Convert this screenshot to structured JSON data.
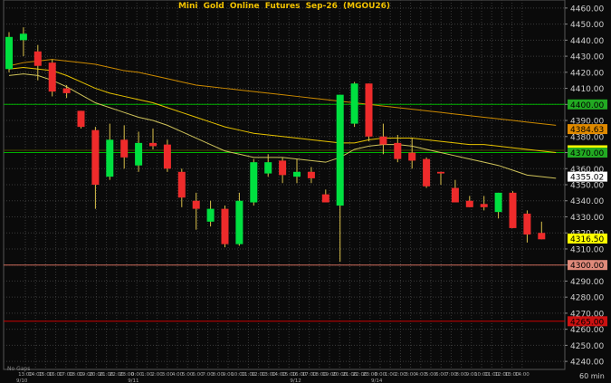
{
  "chart_data": {
    "type": "candlestick",
    "title": "Mini Gold Online Futures Sep-26 (MGOU26)",
    "timeframe_label": "60 min",
    "footnote": "No Gaps",
    "ylim": [
      4235,
      4465
    ],
    "y_ticks": [
      4460,
      4450,
      4440,
      4430,
      4420,
      4410,
      4400,
      4390,
      4380,
      4370,
      4360,
      4350,
      4340,
      4330,
      4320,
      4310,
      4300,
      4290,
      4280,
      4270,
      4260,
      4250,
      4240
    ],
    "x_tick_labels": [
      "13:00",
      "14:00",
      "15:00",
      "16:00",
      "17:00",
      "18:00",
      "19:00",
      "20:00",
      "21:00",
      "22:00",
      "23:00",
      "0:00",
      "1:00",
      "2:00",
      "3:00",
      "4:00",
      "5:00",
      "6:00",
      "7:00",
      "8:00",
      "9:00",
      "10:00",
      "11:00",
      "12:00",
      "13:00",
      "14:00",
      "15:00",
      "16:00",
      "17:00",
      "18:00",
      "19:00",
      "20:00",
      "21:00",
      "22:00",
      "23:00",
      "0:00",
      "1:00",
      "2:00",
      "3:00",
      "4:00",
      "5:00",
      "6:00",
      "7:00",
      "8:00",
      "9:00",
      "10:00",
      "11:00",
      "12:00",
      "13:00",
      "14:00"
    ],
    "date_labels": [
      {
        "text": "9/10",
        "index": 0
      },
      {
        "text": "9/11",
        "index": 11
      },
      {
        "text": "9/12",
        "index": 27
      },
      {
        "text": "9/14",
        "index": 35
      }
    ],
    "candles": [
      {
        "o": 4422,
        "h": 4445,
        "l": 4420,
        "c": 4442
      },
      {
        "o": 4440,
        "h": 4448,
        "l": 4430,
        "c": 4444
      },
      {
        "o": 4433,
        "h": 4437,
        "l": 4415,
        "c": 4424
      },
      {
        "o": 4426,
        "h": 4428,
        "l": 4405,
        "c": 4408
      },
      {
        "o": 4410,
        "h": 4412,
        "l": 4404,
        "c": 4407
      },
      {
        "o": 4396,
        "h": 4396,
        "l": 4385,
        "c": 4386
      },
      {
        "o": 4384,
        "h": 4386,
        "l": 4335,
        "c": 4350
      },
      {
        "o": 4355,
        "h": 4388,
        "l": 4353,
        "c": 4378
      },
      {
        "o": 4378,
        "h": 4387,
        "l": 4360,
        "c": 4367
      },
      {
        "o": 4362,
        "h": 4383,
        "l": 4358,
        "c": 4376
      },
      {
        "o": 4376,
        "h": 4385,
        "l": 4372,
        "c": 4374
      },
      {
        "o": 4375,
        "h": 4378,
        "l": 4358,
        "c": 4360
      },
      {
        "o": 4358,
        "h": 4360,
        "l": 4336,
        "c": 4342
      },
      {
        "o": 4340,
        "h": 4345,
        "l": 4322,
        "c": 4335
      },
      {
        "o": 4327,
        "h": 4340,
        "l": 4324,
        "c": 4335
      },
      {
        "o": 4335,
        "h": 4337,
        "l": 4311,
        "c": 4313
      },
      {
        "o": 4313,
        "h": 4345,
        "l": 4312,
        "c": 4340
      },
      {
        "o": 4339,
        "h": 4366,
        "l": 4337,
        "c": 4364
      },
      {
        "o": 4357,
        "h": 4369,
        "l": 4355,
        "c": 4364
      },
      {
        "o": 4365,
        "h": 4367,
        "l": 4351,
        "c": 4356
      },
      {
        "o": 4355,
        "h": 4366,
        "l": 4351,
        "c": 4358
      },
      {
        "o": 4358,
        "h": 4361,
        "l": 4351,
        "c": 4354
      },
      {
        "o": 4344,
        "h": 4347,
        "l": 4341,
        "c": 4339
      },
      {
        "o": 4337,
        "h": 4406,
        "l": 4302,
        "c": 4406
      },
      {
        "o": 4388,
        "h": 4414,
        "l": 4386,
        "c": 4413
      },
      {
        "o": 4413,
        "h": 4413,
        "l": 4377,
        "c": 4380
      },
      {
        "o": 4380,
        "h": 4388,
        "l": 4369,
        "c": 4375
      },
      {
        "o": 4376,
        "h": 4381,
        "l": 4364,
        "c": 4366
      },
      {
        "o": 4370,
        "h": 4379,
        "l": 4360,
        "c": 4365
      },
      {
        "o": 4366,
        "h": 4367,
        "l": 4348,
        "c": 4349
      },
      {
        "o": 4358,
        "h": 4358,
        "l": 4350,
        "c": 4357
      },
      {
        "o": 4348,
        "h": 4353,
        "l": 4339,
        "c": 4339
      },
      {
        "o": 4340,
        "h": 4343,
        "l": 4336,
        "c": 4336
      },
      {
        "o": 4338,
        "h": 4343,
        "l": 4334,
        "c": 4336
      },
      {
        "o": 4333,
        "h": 4345,
        "l": 4329,
        "c": 4345
      },
      {
        "o": 4345,
        "h": 4346,
        "l": 4323,
        "c": 4323
      },
      {
        "o": 4332,
        "h": 4334,
        "l": 4314,
        "c": 4319
      },
      {
        "o": 4320,
        "h": 4327,
        "l": 4316,
        "c": 4316
      }
    ],
    "moving_averages": [
      {
        "color": "#cc8a00",
        "points": [
          4424,
          4426,
          4427,
          4428,
          4427,
          4426,
          4425,
          4423,
          4421,
          4420,
          4418,
          4416,
          4414,
          4412,
          4411,
          4410,
          4409,
          4408,
          4407,
          4406,
          4405,
          4404,
          4403,
          4402,
          4401,
          4400,
          4399,
          4398,
          4397,
          4396,
          4395,
          4394,
          4393,
          4392,
          4391,
          4390,
          4389,
          4388,
          4387
        ]
      },
      {
        "color": "#e6c200",
        "points": [
          4422,
          4423,
          4422,
          4421,
          4418,
          4414,
          4410,
          4407,
          4405,
          4403,
          4401,
          4398,
          4395,
          4392,
          4389,
          4386,
          4384,
          4382,
          4381,
          4380,
          4379,
          4378,
          4377,
          4376,
          4376,
          4378,
          4379,
          4379,
          4379,
          4378,
          4377,
          4376,
          4375,
          4375,
          4374,
          4373,
          4372,
          4371,
          4370
        ]
      },
      {
        "color": "#cfc35a",
        "points": [
          4418,
          4419,
          4418,
          4415,
          4411,
          4406,
          4401,
          4398,
          4395,
          4392,
          4390,
          4387,
          4383,
          4379,
          4375,
          4371,
          4369,
          4367,
          4367,
          4367,
          4366,
          4365,
          4364,
          4367,
          4372,
          4374,
          4375,
          4375,
          4374,
          4372,
          4370,
          4368,
          4366,
          4364,
          4362,
          4359,
          4356,
          4355,
          4354
        ]
      }
    ],
    "horizontal_lines": [
      {
        "value": 4400.0,
        "label": "4400.00",
        "line_color": "#00b000",
        "label_bg": "#22aa22",
        "label_color": "#000000"
      },
      {
        "value": 4371.43,
        "label": "4371.43",
        "line_color": "#4a4a00",
        "label_bg": "#ffff00",
        "label_color": "#000000"
      },
      {
        "value": 4370.0,
        "label": "4370.00",
        "line_color": "#00b000",
        "label_bg": "#22aa22",
        "label_color": "#000000"
      },
      {
        "value": 4300.0,
        "label": "4300.00",
        "line_color": "#cc6b5a",
        "label_bg": "#e08a7a",
        "label_color": "#000000"
      },
      {
        "value": 4265.0,
        "label": "4265.00",
        "line_color": "#cc0000",
        "label_bg": "#cc1111",
        "label_color": "#000000"
      }
    ],
    "price_markers": [
      {
        "value": 4384.63,
        "label": "4384.63",
        "bg": "#e08a00",
        "color": "#000000"
      },
      {
        "value": 4355.02,
        "label": "4355.02",
        "bg": "#ffffff",
        "color": "#000000"
      },
      {
        "value": 4316.5,
        "label": "4316.50",
        "bg": "#ffff00",
        "color": "#000000"
      }
    ],
    "colors": {
      "background": "#0a0a0a",
      "grid": "#3a3a3a",
      "up": "#00e040",
      "down": "#ee2b2b",
      "wick": "#d9c04a",
      "title": "#f2c200",
      "axis_text": "#cfcfcf"
    }
  }
}
